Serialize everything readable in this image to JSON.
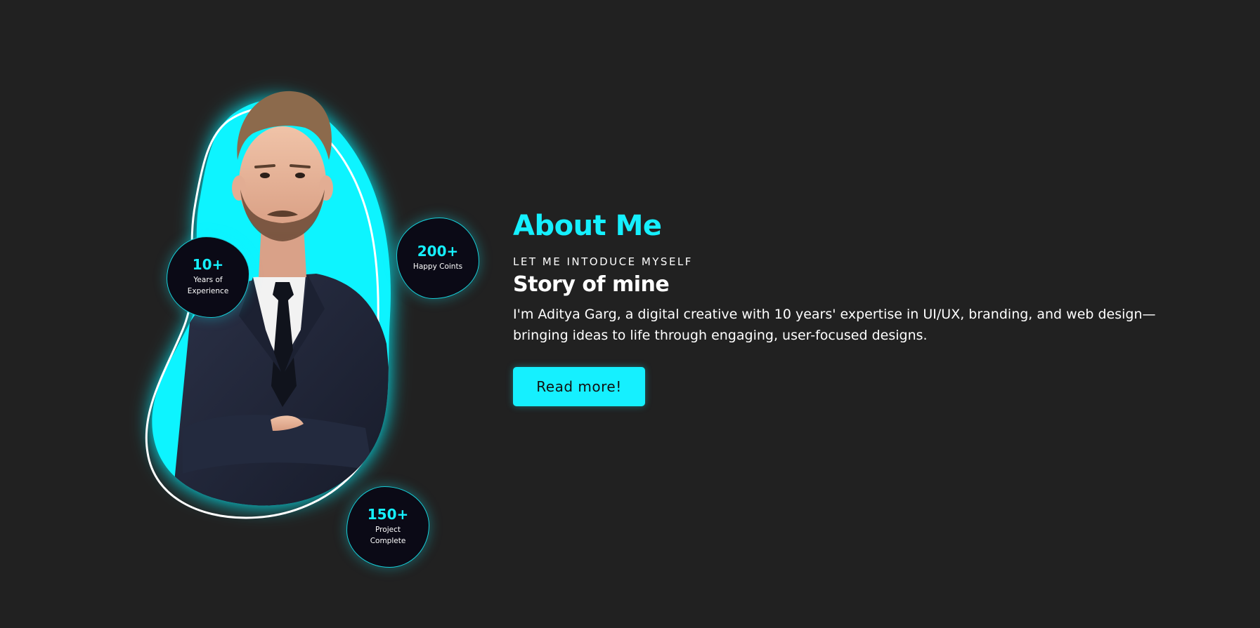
{
  "about": {
    "title": "About Me",
    "eyebrow": "LET ME INTODUCE MYSELF",
    "subtitle": "Story of mine",
    "description": "I'm Aditya Garg, a digital creative with 10 years' expertise in UI/UX, branding, and web design—bringing ideas to life through engaging, user-focused designs.",
    "button_label": "Read more!"
  },
  "stats": {
    "experience": {
      "value": "10+",
      "label": "Years of Experience"
    },
    "clients": {
      "value": "200+",
      "label": "Happy Coints"
    },
    "projects": {
      "value": "150+",
      "label": "Project Complete"
    }
  },
  "colors": {
    "background": "#212121",
    "accent": "#15f0ff",
    "badge_bg": "#0b0a16",
    "text": "#ffffff"
  },
  "icons": {
    "portrait": "person-in-suit-portrait"
  }
}
